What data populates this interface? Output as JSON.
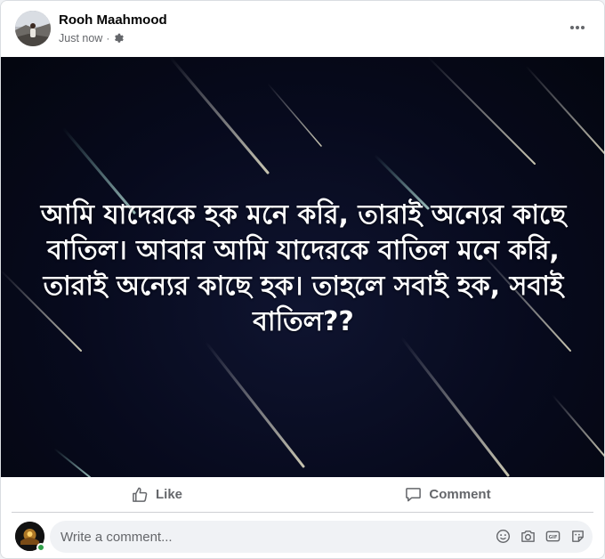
{
  "post": {
    "author": "Rooh Maahmood",
    "time": "Just now",
    "separator": "·",
    "audience_icon": "gear-icon",
    "more_icon": "more-horizontal-icon",
    "quote": "আমি যাদেরকে হক মনে করি, তারাই অন্যের কাছে বাতিল। আবার আমি যাদেরকে বাতিল মনে করি, তারাই অন্যের কাছে হক। তাহলে সবাই হক, সবাই বাতিল??"
  },
  "actions": {
    "like_label": "Like",
    "comment_label": "Comment"
  },
  "comment": {
    "placeholder": "Write a comment...",
    "tools": [
      "emoji-icon",
      "camera-icon",
      "gif-icon",
      "sticker-icon"
    ]
  },
  "colors": {
    "online": "#31a24c",
    "secondary_text": "#65676b",
    "image_bg": "#070a1d"
  }
}
